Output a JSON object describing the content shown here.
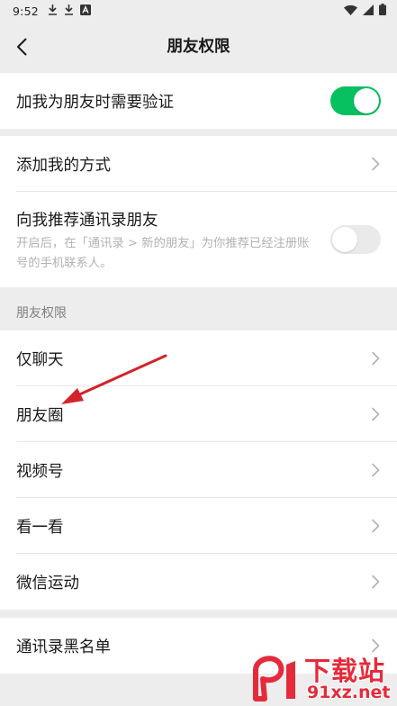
{
  "status_bar": {
    "time": "9:52",
    "left_icons": [
      "download-icon",
      "download-icon",
      "text-app-icon"
    ],
    "right_icons": [
      "wifi-icon",
      "signal-icon",
      "battery-icon"
    ]
  },
  "nav": {
    "title": "朋友权限",
    "back_icon": "chevron-left-icon"
  },
  "group1": {
    "verify_label": "加我为朋友时需要验证",
    "verify_on": true
  },
  "group2": {
    "add_me_label": "添加我的方式",
    "recommend_label": "向我推荐通讯录朋友",
    "recommend_desc": "开启后，在「通讯录 > 新的朋友」为你推荐已经注册账号的手机联系人。",
    "recommend_on": false
  },
  "section": {
    "header": "朋友权限",
    "items": [
      {
        "label": "仅聊天"
      },
      {
        "label": "朋友圈"
      },
      {
        "label": "视频号"
      },
      {
        "label": "看一看"
      },
      {
        "label": "微信运动"
      }
    ]
  },
  "group4": {
    "blacklist_label": "通讯录黑名单"
  },
  "watermark": {
    "title": "下载站",
    "url": "91xz.net"
  },
  "colors": {
    "accent": "#07c160",
    "background": "#ededed",
    "arrow": "#d2232a",
    "watermark": "#e52b3b"
  }
}
